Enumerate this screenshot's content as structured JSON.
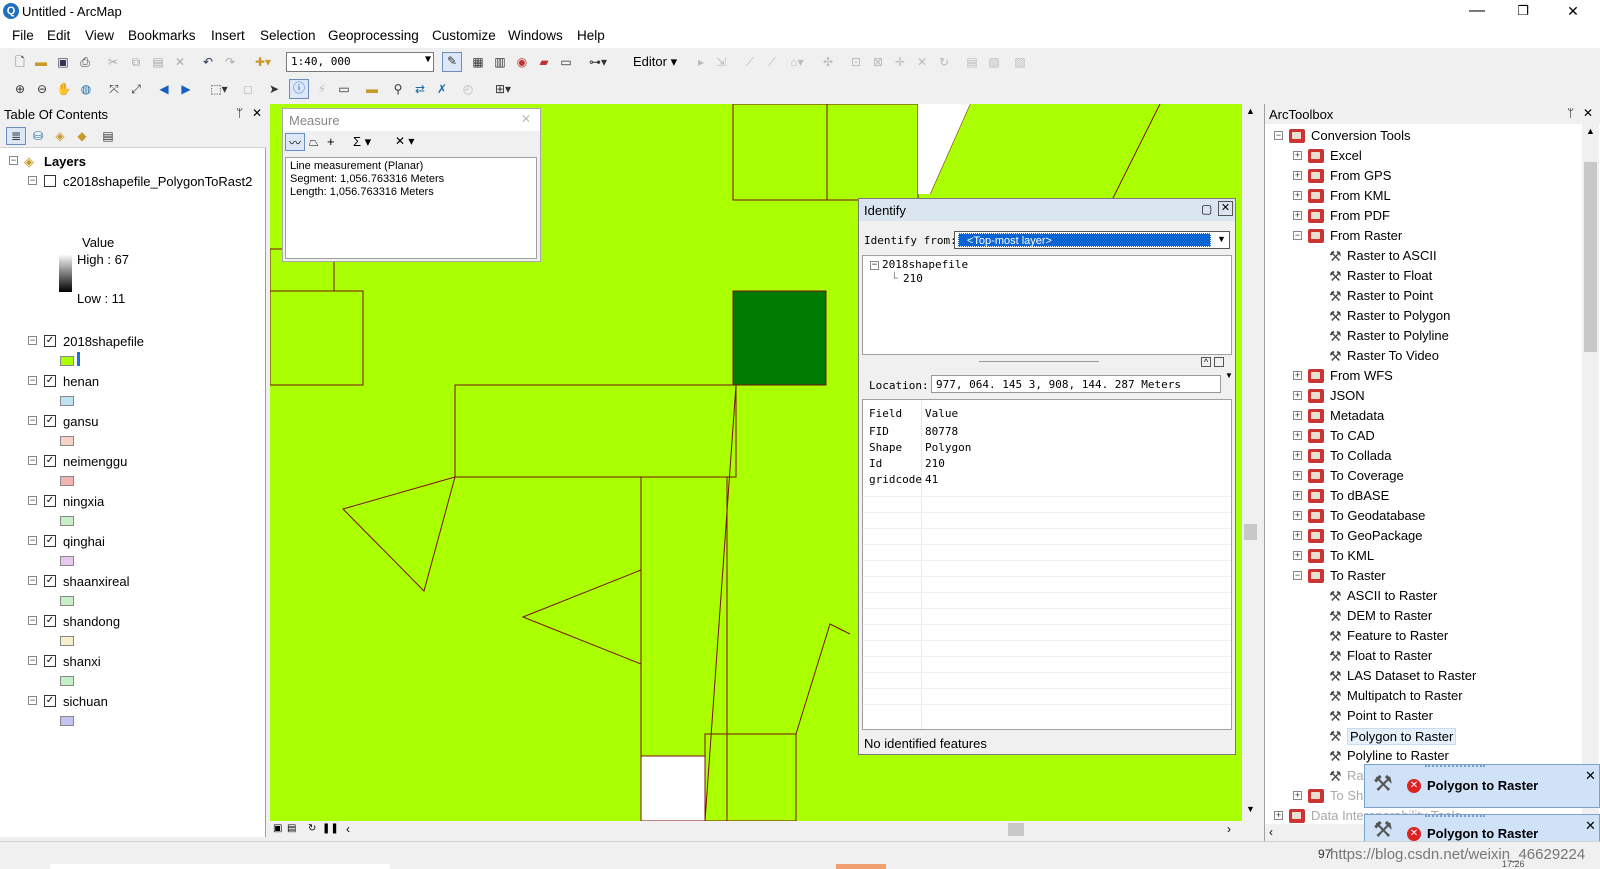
{
  "window": {
    "title": "Untitled - ArcMap",
    "app_icon": "Q",
    "min": "—",
    "max": "❐",
    "close": "✕"
  },
  "menu": [
    "File",
    "Edit",
    "View",
    "Bookmarks",
    "Insert",
    "Selection",
    "Geoprocessing",
    "Customize",
    "Windows",
    "Help"
  ],
  "toolbar": {
    "scale": "1:40, 000",
    "editor": "Editor ▾"
  },
  "toc": {
    "title": "Table Of Contents",
    "pin": "ᛘ",
    "close": "✕",
    "root": "Layers",
    "raster_layer": {
      "name": "c2018shapefile_PolygonToRast2",
      "value_label": "Value",
      "high": "High : 67",
      "low": "Low : 11"
    },
    "layers": [
      {
        "name": "2018shapefile",
        "color": "#aaff00"
      },
      {
        "name": "henan",
        "color": "#bfe3f5"
      },
      {
        "name": "gansu",
        "color": "#f5d3c9"
      },
      {
        "name": "neimenggu",
        "color": "#f5b2b2"
      },
      {
        "name": "ningxia",
        "color": "#c9f0c4"
      },
      {
        "name": "qinghai",
        "color": "#e8c8f0"
      },
      {
        "name": "shaanxireal",
        "color": "#c9f0c4"
      },
      {
        "name": "shandong",
        "color": "#f5f0c9"
      },
      {
        "name": "shanxi",
        "color": "#c4f0c4"
      },
      {
        "name": "sichuan",
        "color": "#c4c4f0"
      }
    ]
  },
  "measure": {
    "title": "Measure",
    "line1": "Line measurement (Planar)",
    "line2": "Segment: 1,056.763316 Meters",
    "line3": "Length: 1,056.763316 Meters"
  },
  "identify": {
    "title": "Identify",
    "from_label": "Identify from:",
    "from_value": "<Top-most layer>",
    "tree_root": "2018shapefile",
    "tree_child": "210",
    "location_label": "Location:",
    "location_value": "977, 064. 145   3, 908, 144. 287 Meters",
    "col_field": "Field",
    "col_value": "Value",
    "rows": [
      {
        "field": "FID",
        "value": "80778"
      },
      {
        "field": "Shape",
        "value": "Polygon"
      },
      {
        "field": "Id",
        "value": "210"
      },
      {
        "field": "gridcode",
        "value": "41"
      }
    ],
    "status": "No identified features"
  },
  "arctoolbox": {
    "title": "ArcToolbox",
    "root": "Conversion Tools",
    "items": [
      {
        "label": "Excel",
        "kind": "toolset",
        "exp": "+"
      },
      {
        "label": "From GPS",
        "kind": "toolset",
        "exp": "+"
      },
      {
        "label": "From KML",
        "kind": "toolset",
        "exp": "+"
      },
      {
        "label": "From PDF",
        "kind": "toolset",
        "exp": "+"
      },
      {
        "label": "From Raster",
        "kind": "toolset",
        "exp": "−"
      },
      {
        "label": "Raster to ASCII",
        "kind": "tool"
      },
      {
        "label": "Raster to Float",
        "kind": "tool"
      },
      {
        "label": "Raster to Point",
        "kind": "tool"
      },
      {
        "label": "Raster to Polygon",
        "kind": "tool"
      },
      {
        "label": "Raster to Polyline",
        "kind": "tool"
      },
      {
        "label": "Raster To Video",
        "kind": "tool"
      },
      {
        "label": "From WFS",
        "kind": "toolset",
        "exp": "+"
      },
      {
        "label": "JSON",
        "kind": "toolset",
        "exp": "+"
      },
      {
        "label": "Metadata",
        "kind": "toolset",
        "exp": "+"
      },
      {
        "label": "To CAD",
        "kind": "toolset",
        "exp": "+"
      },
      {
        "label": "To Collada",
        "kind": "toolset",
        "exp": "+"
      },
      {
        "label": "To Coverage",
        "kind": "toolset",
        "exp": "+"
      },
      {
        "label": "To dBASE",
        "kind": "toolset",
        "exp": "+"
      },
      {
        "label": "To Geodatabase",
        "kind": "toolset",
        "exp": "+"
      },
      {
        "label": "To GeoPackage",
        "kind": "toolset",
        "exp": "+"
      },
      {
        "label": "To KML",
        "kind": "toolset",
        "exp": "+"
      },
      {
        "label": "To Raster",
        "kind": "toolset",
        "exp": "−"
      },
      {
        "label": "ASCII to Raster",
        "kind": "tool"
      },
      {
        "label": "DEM to Raster",
        "kind": "tool"
      },
      {
        "label": "Feature to Raster",
        "kind": "tool"
      },
      {
        "label": "Float to Raster",
        "kind": "tool"
      },
      {
        "label": "LAS Dataset to Raster",
        "kind": "tool"
      },
      {
        "label": "Multipatch to Raster",
        "kind": "tool"
      },
      {
        "label": "Point to Raster",
        "kind": "tool"
      },
      {
        "label": "Polygon to Raster",
        "kind": "tool",
        "hl": true
      },
      {
        "label": "Polyline to Raster",
        "kind": "tool"
      },
      {
        "label": "Raster To Other Format (multiple)",
        "kind": "tool",
        "faded": true
      },
      {
        "label": "To Shapefile",
        "kind": "toolset",
        "exp": "+",
        "faded": true
      },
      {
        "label": "Data Interoperability Tools",
        "kind": "box",
        "exp": "+",
        "faded": true
      }
    ]
  },
  "notifications": [
    {
      "title": "Polygon to Raster",
      "close": "✕"
    },
    {
      "title": "Polygon to Raster",
      "close": "✕"
    }
  ],
  "watermark": "https://blog.csdn.net/weixin_46629224",
  "status_coord": "97",
  "status_time": "17:26"
}
